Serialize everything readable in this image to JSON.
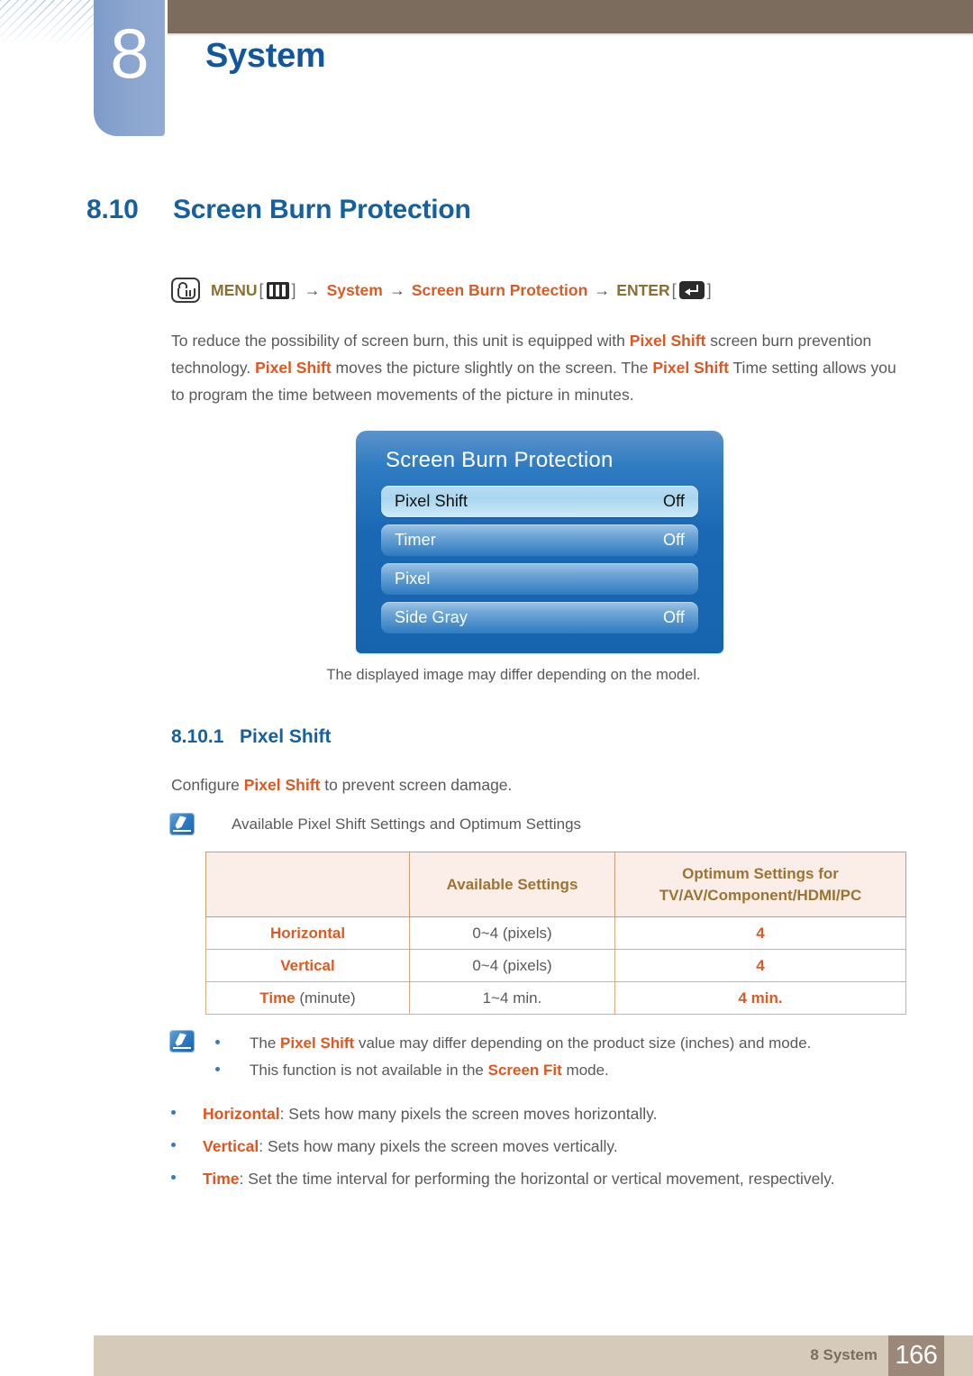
{
  "header": {
    "chapter_number": "8",
    "chapter_title": "System"
  },
  "section": {
    "number": "8.10",
    "title": "Screen Burn Protection"
  },
  "nav_path": {
    "hand_icon": "hand-press-icon",
    "menu_label": "MENU",
    "menu_icon": "menu-bars-icon",
    "arrow": "→",
    "item1": "System",
    "item2": "Screen Burn Protection",
    "enter_label": "ENTER",
    "enter_icon": "enter-arrow-icon",
    "bracket_open": "[",
    "bracket_close": "]"
  },
  "intro": {
    "p1_a": "To reduce the possibility of screen burn, this unit is equipped with ",
    "p1_kw1": "Pixel Shift",
    "p1_b": " screen burn prevention technology. ",
    "p1_kw2": "Pixel Shift",
    "p1_c": " moves the picture slightly on the screen. The ",
    "p1_kw3": "Pixel Shift",
    "p1_d": " Time setting allows you to program the time between movements of the picture in minutes."
  },
  "osd": {
    "title": "Screen Burn Protection",
    "rows": [
      {
        "label": "Pixel Shift",
        "value": "Off",
        "selected": true
      },
      {
        "label": "Timer",
        "value": "Off",
        "selected": false
      },
      {
        "label": "Pixel",
        "value": "",
        "selected": false
      },
      {
        "label": "Side Gray",
        "value": "Off",
        "selected": false
      }
    ],
    "caption": "The displayed image may differ depending on the model."
  },
  "subsection": {
    "number": "8.10.1",
    "title": "Pixel Shift",
    "desc_a": "Configure ",
    "desc_kw": "Pixel Shift",
    "desc_b": " to prevent screen damage."
  },
  "note_top": {
    "icon": "note-pencil-icon",
    "text": "Available Pixel Shift Settings and Optimum Settings"
  },
  "table": {
    "headers": [
      "",
      "Available Settings",
      "Optimum Settings for\nTV/AV/Component/HDMI/PC"
    ],
    "header_col2": "Available Settings",
    "header_col3_line1": "Optimum Settings for",
    "header_col3_line2": "TV/AV/Component/HDMI/PC",
    "rows": [
      {
        "label": "Horizontal",
        "label_sub": "",
        "available": "0~4 (pixels)",
        "optimum": "4"
      },
      {
        "label": "Vertical",
        "label_sub": "",
        "available": "0~4 (pixels)",
        "optimum": "4"
      },
      {
        "label": "Time",
        "label_sub": " (minute)",
        "available": "1~4 min.",
        "optimum": "4 min."
      }
    ]
  },
  "note_bottom": {
    "icon": "note-pencil-icon",
    "items": [
      {
        "a": "The ",
        "kw": "Pixel Shift",
        "b": " value may differ depending on the product size (inches) and mode."
      },
      {
        "a": "This function is not available in the ",
        "kw": "Screen Fit",
        "b": " mode."
      }
    ]
  },
  "bullets": [
    {
      "kw": "Horizontal",
      "text": ": Sets how many pixels the screen moves horizontally."
    },
    {
      "kw": "Vertical",
      "text": ": Sets how many pixels the screen moves vertically."
    },
    {
      "kw": "Time",
      "text": ": Set the time interval for performing the horizontal or vertical movement, respectively."
    }
  ],
  "footer": {
    "label": "8 System",
    "page_number": "166"
  },
  "colors": {
    "accent_blue": "#16609f",
    "accent_orange": "#dd5a24",
    "brown": "#7b6c5e",
    "tan": "#d6cbba",
    "osd_blue": "#1764ae",
    "table_header_bg": "#fbeee8",
    "table_header_text": "#9b7434"
  }
}
